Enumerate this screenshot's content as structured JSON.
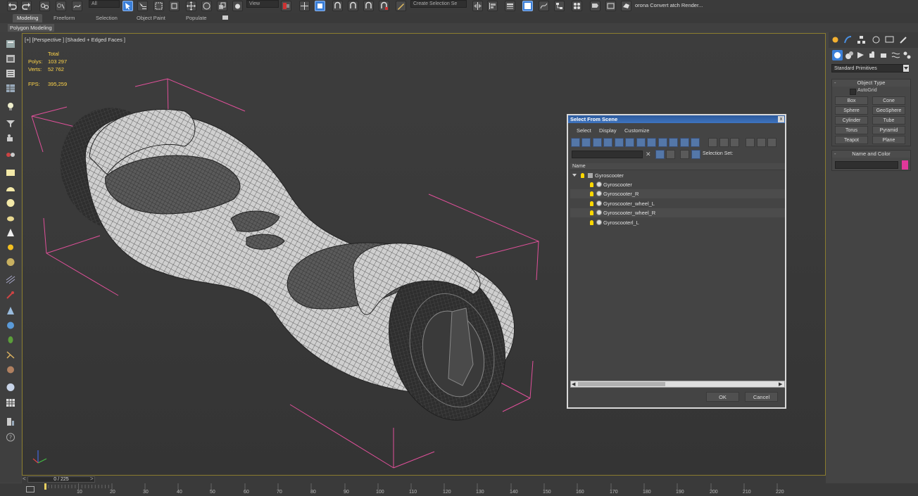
{
  "toolbar": {
    "selection_filter": "All",
    "view_dropdown": "View",
    "selection_set": "Create Selection Se",
    "render_label": "orona Convert atch Render..."
  },
  "ribbon": {
    "tabs": [
      "Modeling",
      "Freeform",
      "Selection",
      "Object Paint",
      "Populate"
    ],
    "active_tab": "Modeling",
    "sub_tab": "Polygon Modeling"
  },
  "viewport": {
    "label": "[+] [Perspective ] [Shaded + Edged Faces ]",
    "stats": {
      "total_label": "Total",
      "polys_label": "Polys:",
      "polys_value": "103 297",
      "verts_label": "Verts:",
      "verts_value": "52 762",
      "fps_label": "FPS:",
      "fps_value": "395,259"
    }
  },
  "dialog": {
    "title": "Select From Scene",
    "close": "x",
    "menus": [
      "Select",
      "Display",
      "Customize"
    ],
    "selection_set_label": "Selection Set:",
    "column_name": "Name",
    "tree": [
      {
        "name": "Gyroscooter",
        "level": 0
      },
      {
        "name": "Gyroscooter",
        "level": 1
      },
      {
        "name": "Gyroscooter_R",
        "level": 1
      },
      {
        "name": "Gyroscooter_wheel_L",
        "level": 1
      },
      {
        "name": "Gyroscooter_wheel_R",
        "level": 1
      },
      {
        "name": "Gyroscooterl_L",
        "level": 1
      }
    ],
    "ok": "OK",
    "cancel": "Cancel"
  },
  "command_panel": {
    "primitive_dropdown": "Standard Primitives",
    "object_type_title": "Object Type",
    "autogrid": "AutoGrid",
    "buttons": [
      "Box",
      "Cone",
      "Sphere",
      "GeoSphere",
      "Cylinder",
      "Tube",
      "Torus",
      "Pyramid",
      "Teapot",
      "Plane"
    ],
    "name_color_title": "Name and Color",
    "color_swatch": "#e0389a"
  },
  "timeline": {
    "frame": "0 / 225",
    "ticks": [
      "10",
      "20",
      "30",
      "40",
      "50",
      "60",
      "70",
      "80",
      "90",
      "100",
      "110",
      "120",
      "130",
      "140",
      "150",
      "160",
      "170",
      "180",
      "190",
      "200",
      "210",
      "220"
    ]
  },
  "colors": {
    "accent": "#3b7fd8",
    "stat_yellow": "#ffd54a",
    "bbox_pink": "#e0509a"
  }
}
